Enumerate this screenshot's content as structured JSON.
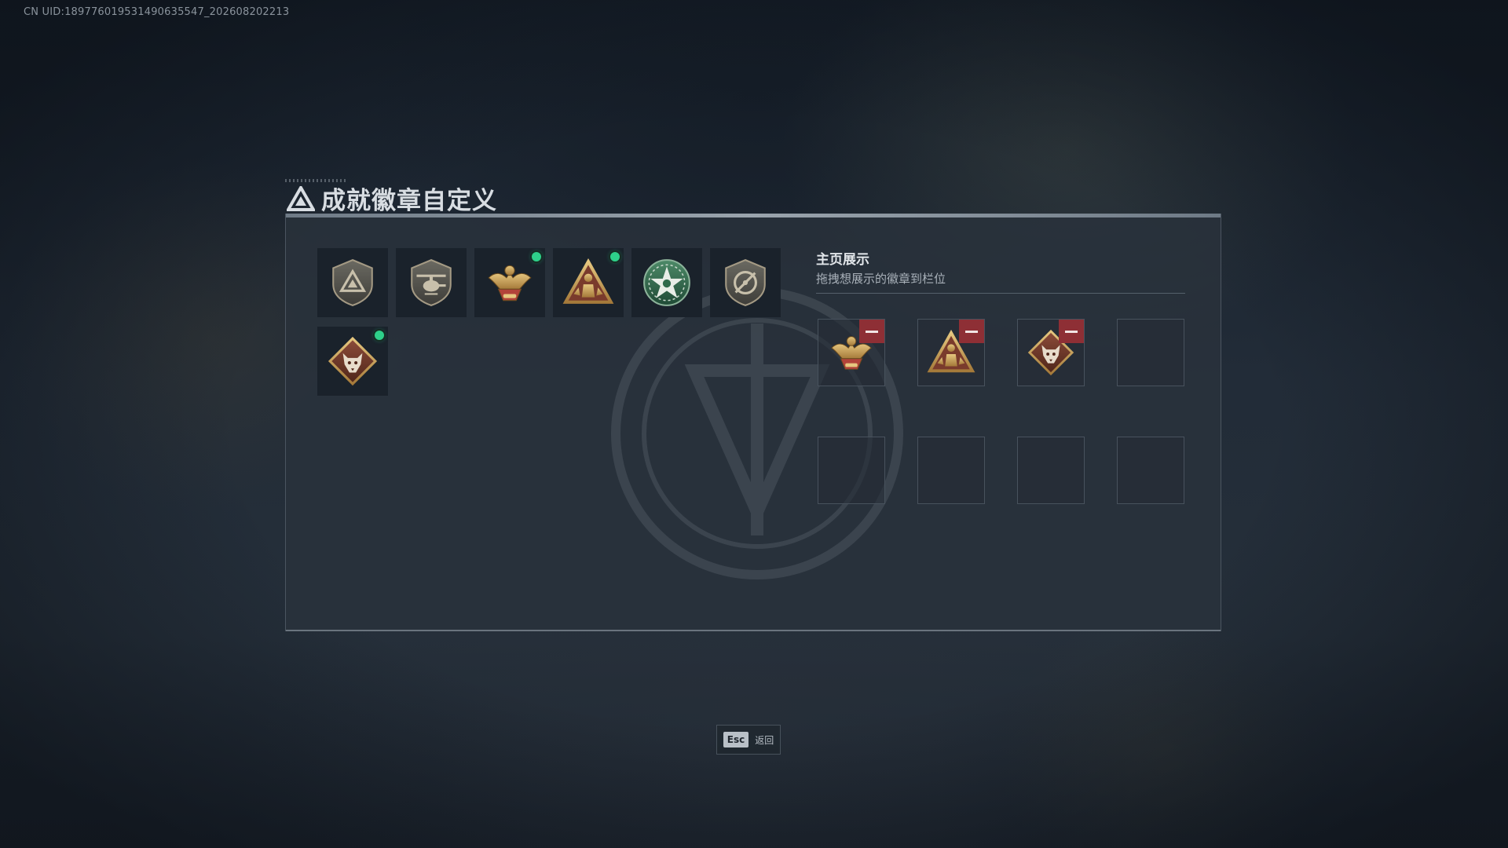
{
  "uid_text": "CN UID:18977601953149063554​7_202608202213",
  "dialog": {
    "title": "成就徽章自定义"
  },
  "badges": [
    {
      "icon": "shield-triangle-badge-icon",
      "new": false
    },
    {
      "icon": "helicopter-shield-badge-icon",
      "new": false
    },
    {
      "icon": "golden-eagle-badge-icon",
      "new": true
    },
    {
      "icon": "soldier-triangle-badge-icon",
      "new": true
    },
    {
      "icon": "green-star-badge-icon",
      "new": false
    },
    {
      "icon": "crosshair-shield-badge-icon",
      "new": false
    },
    {
      "icon": "wolf-diamond-badge-icon",
      "new": true
    }
  ],
  "showcase": {
    "title": "主页展示",
    "subtitle": "拖拽想展示的徽章到栏位",
    "slots": [
      {
        "icon": "golden-eagle-badge-icon",
        "filled": true
      },
      {
        "icon": "soldier-triangle-badge-icon",
        "filled": true
      },
      {
        "icon": "wolf-diamond-badge-icon",
        "filled": true
      },
      {
        "filled": false
      },
      {
        "filled": false
      },
      {
        "filled": false
      },
      {
        "filled": false
      },
      {
        "filled": false
      }
    ]
  },
  "footer": {
    "esc_key": "Esc",
    "esc_label": "返回"
  },
  "colors": {
    "new_dot": "#2ed08a",
    "remove": "#8e2f35",
    "gold": "#c9a25a"
  }
}
